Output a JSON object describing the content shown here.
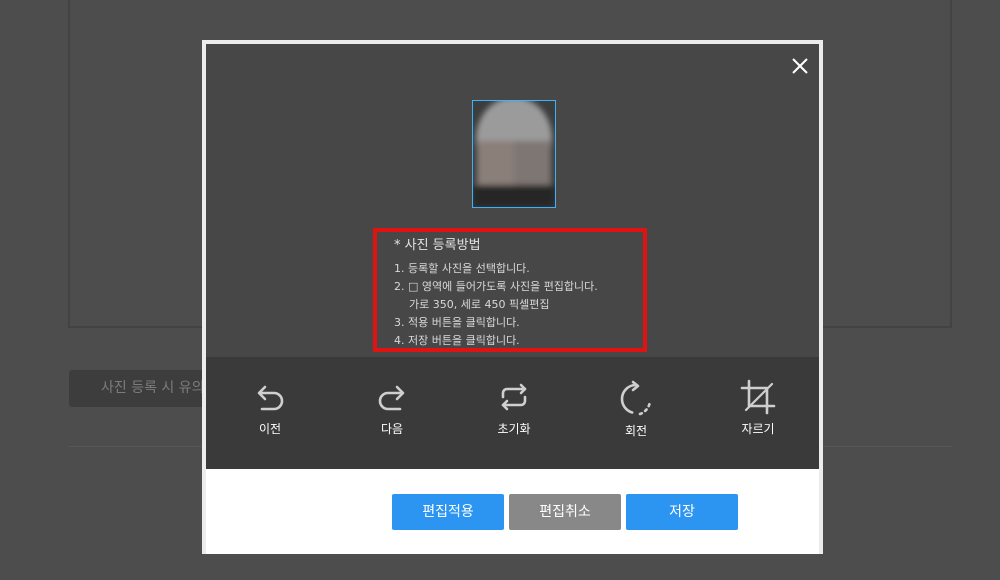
{
  "background": {
    "notice_button_label": "사진 등록 시 유의"
  },
  "modal": {
    "guide": {
      "title": "* 사진 등록방법",
      "steps": [
        "1. 등록할 사진을 선택합니다.",
        "2. □ 영역에 들어가도록 사진을 편집합니다.",
        "가로 350, 세로 450 픽셀편집",
        "3. 적용 버튼을 클릭합니다.",
        "4. 저장 버튼을 클릭합니다."
      ]
    },
    "toolbar": {
      "undo": "이전",
      "redo": "다음",
      "reset": "초기화",
      "rotate": "회전",
      "crop": "자르기"
    },
    "actions": {
      "apply": "편집적용",
      "cancel": "편집취소",
      "save": "저장"
    },
    "colors": {
      "primary": "#2b95f1",
      "secondary": "#888888",
      "highlight_border": "#e11212",
      "crop_frame": "#38b4ff"
    }
  }
}
